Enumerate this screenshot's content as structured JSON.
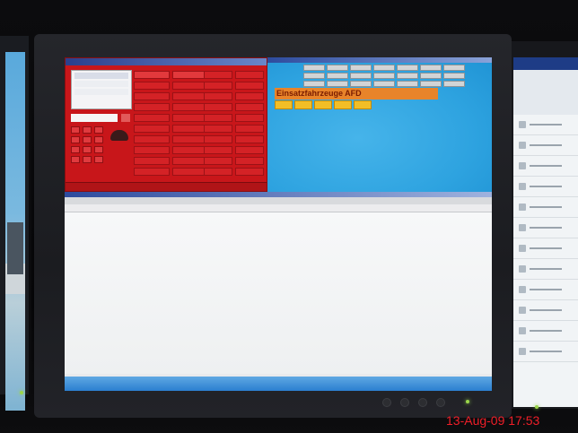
{
  "photo": {
    "timestamp": "13-Aug-09 17:53"
  },
  "dispatch_app": {
    "incident_title": "Einsatzfahrzeuge AFD"
  }
}
